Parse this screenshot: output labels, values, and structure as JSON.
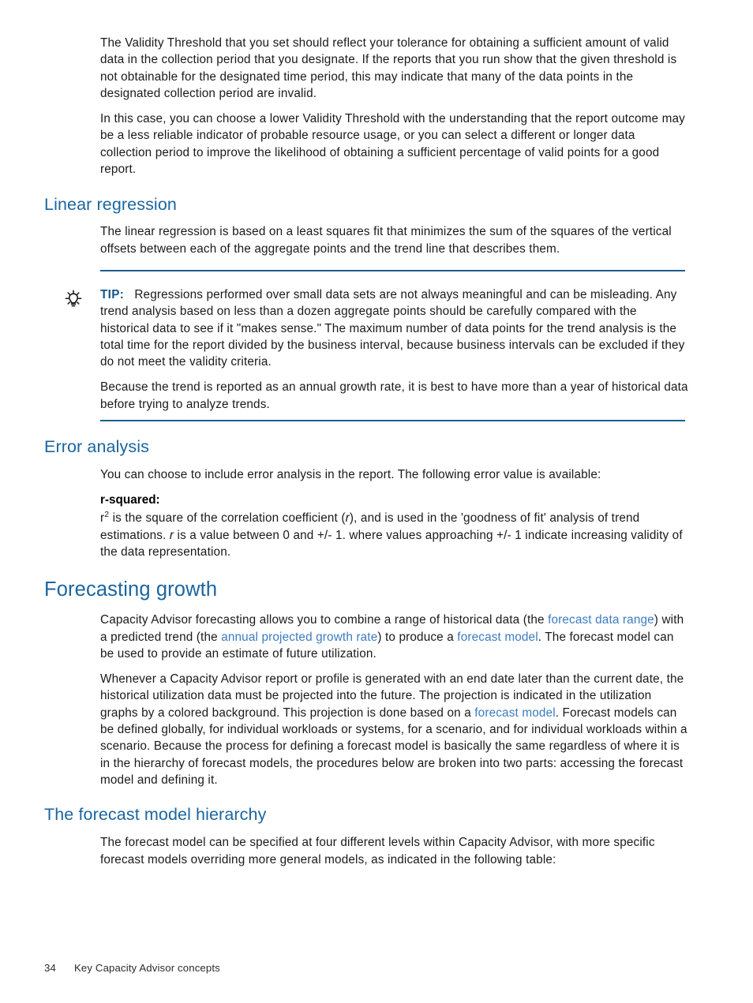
{
  "document": {
    "footer": {
      "page_number": "34",
      "section_title": "Key Capacity Advisor concepts"
    }
  },
  "intro": {
    "paragraph_1": "The Validity Threshold that you set should reflect your tolerance for obtaining a sufficient amount of valid data in the collection period that you designate. If the reports that you run show that the given threshold is not obtainable for the designated time period, this may indicate that many of the data points in the designated collection period are invalid.",
    "paragraph_2": "In this case, you can choose a lower Validity Threshold with the understanding that the report outcome may be a less reliable indicator of probable resource usage, or you can select a different or longer data collection period to improve the likelihood of obtaining a sufficient percentage of valid points for a good report."
  },
  "linear_regression": {
    "heading": "Linear regression",
    "paragraph_1": "The linear regression is based on a least squares fit that minimizes the sum of the squares of the vertical offsets between each of the aggregate points and the trend line that describes them.",
    "tip": {
      "icon": "lightbulb-icon",
      "label": "TIP:",
      "paragraph_1": "Regressions performed over small data sets are not always meaningful and can be misleading. Any trend analysis based on less than a dozen aggregate points should be carefully compared with the historical data to see if it \"makes sense.\" The maximum number of data points for the trend analysis is the total time for the report divided by the business interval, because business intervals can be excluded if they do not meet the validity criteria.",
      "paragraph_2": "Because the trend is reported as an annual growth rate, it is best to have more than a year of historical data before trying to analyze trends."
    }
  },
  "error_analysis": {
    "heading": "Error analysis",
    "paragraph_1": "You can choose to include error analysis in the report. The following error value is available:",
    "term": "r-squared:",
    "definition": {
      "pre": "r",
      "superscript": "2",
      "part_1": " is the square of the correlation coefficient (",
      "var_1": "r",
      "part_2": "), and is used in the 'goodness of fit' analysis of trend estimations. ",
      "var_2": "r",
      "part_3": " is a value between 0 and +/- 1. where values approaching +/- 1 indicate increasing validity of the data representation."
    }
  },
  "forecasting_growth": {
    "heading": "Forecasting growth",
    "paragraph_1": {
      "part_1": "Capacity Advisor forecasting allows you to combine a range of historical data (the ",
      "link_1": "forecast data range",
      "part_2": ") with a predicted trend (the ",
      "link_2": "annual projected growth rate",
      "part_3": ") to produce a ",
      "link_3": "forecast model",
      "part_4": ". The forecast model can be used to provide an estimate of future utilization."
    },
    "paragraph_2": {
      "part_1": "Whenever a Capacity Advisor report or profile is generated with an end date later than the current date, the historical utilization data must be projected into the future. The projection is indicated in the utilization graphs by a colored background. This projection is done based on a ",
      "link_1": "forecast model",
      "part_2": ". Forecast models can be defined globally, for individual workloads or systems, for a scenario, and for individual workloads within a scenario. Because the process for defining a forecast model is basically the same regardless of where it is in the hierarchy of forecast models, the procedures below are broken into two parts: accessing the forecast model and defining it."
    }
  },
  "forecast_model_hierarchy": {
    "heading": "The forecast model hierarchy",
    "paragraph_1": "The forecast model can be specified at four different levels within Capacity Advisor, with more specific forecast models overriding more general models, as indicated in the following table:"
  },
  "colors": {
    "heading_blue": "#1b659f",
    "link_blue": "#3c7cbf",
    "rule_blue": "#1b5e8e",
    "tip_label_blue": "#17558a",
    "body_text": "#1a1a1a",
    "page_background": "#ffffff"
  }
}
